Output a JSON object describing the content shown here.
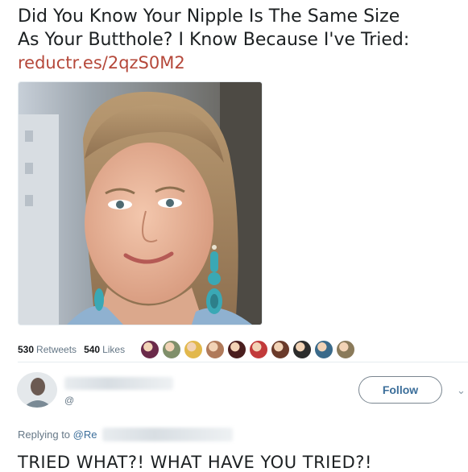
{
  "tweet": {
    "text_line1": "Did You Know Your Nipple Is The Same Size",
    "text_line2": "As Your Butthole? I Know Because I've Tried:",
    "link": "reductr.es/2qzS0M2"
  },
  "stats": {
    "retweets_count": "530",
    "retweets_label": "Retweets",
    "likes_count": "540",
    "likes_label": "Likes",
    "liker_colors": [
      "#6b2a4a",
      "#7f8f6a",
      "#e2b84c",
      "#b07a5a",
      "#4a1e1e",
      "#c23a3a",
      "#6a3a2a",
      "#2c2c2c",
      "#3a6a8a",
      "#8a7a5a"
    ]
  },
  "reply": {
    "handle_prefix": "@",
    "follow_label": "Follow",
    "chevron": "⌄",
    "replying_label": "Replying to",
    "replying_handle": "@Re",
    "text": "TRIED WHAT?! WHAT HAVE YOU TRIED?!"
  },
  "colors": {
    "link": "#b5483a",
    "follow_text": "#3b6e9a",
    "muted": "#657786"
  }
}
